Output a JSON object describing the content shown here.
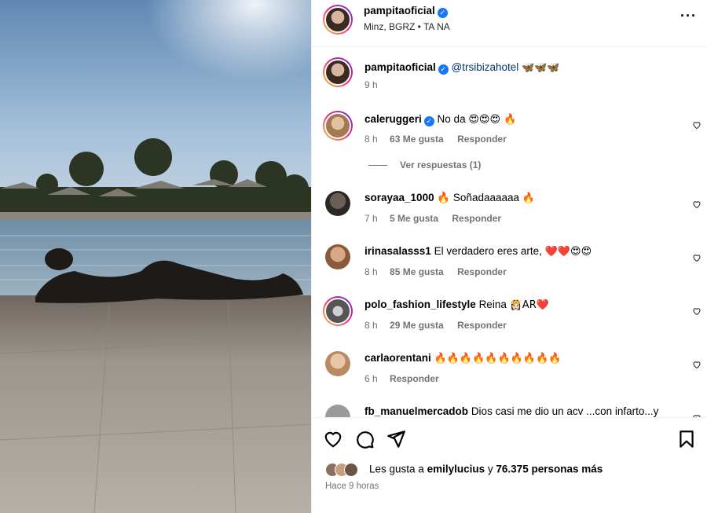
{
  "post": {
    "username": "pampitaoficial",
    "location": "Minz, BGRZ • TA NA"
  },
  "caption": {
    "username": "pampitaoficial",
    "mention": "@trsibizahotel",
    "emojis": "🦋🦋🦋",
    "time": "9 h"
  },
  "comments": [
    {
      "username": "caleruggeri",
      "verified": true,
      "text": "No da",
      "emojis": "😍😍😍 🔥",
      "time": "8 h",
      "likes": "63 Me gusta",
      "reply": "Responder"
    },
    {
      "username": "sorayaa_1000",
      "verified": false,
      "text": "🔥 Soñadaaaaaa",
      "emojis": "🔥",
      "time": "7 h",
      "likes": "5 Me gusta",
      "reply": "Responder"
    },
    {
      "username": "irinasalasss1",
      "verified": false,
      "text": "El verdadero eres arte,",
      "emojis": "❤️❤️😍😍",
      "time": "8 h",
      "likes": "85 Me gusta",
      "reply": "Responder"
    },
    {
      "username": "polo_fashion_lifestyle",
      "verified": false,
      "text": "Reina",
      "emojis": "👸🏻AR❤️",
      "time": "8 h",
      "likes": "29 Me gusta",
      "reply": "Responder"
    },
    {
      "username": "carlaorentani",
      "verified": false,
      "text": "",
      "emojis": "🔥🔥🔥🔥🔥🔥🔥🔥🔥🔥",
      "time": "6 h",
      "likes": "",
      "reply": "Responder"
    },
    {
      "username": "fb_manuelmercadob",
      "verified": false,
      "text": "Dios casi me dio un acv ...con infarto...y",
      "emojis": "",
      "time": "",
      "likes": "",
      "reply": ""
    }
  ],
  "view_replies": "Ver respuestas (1)",
  "likes": {
    "prefix": "Les gusta a",
    "user": "emilylucius",
    "middle": "y",
    "count": "76.375 personas más"
  },
  "posted": "Hace 9 horas",
  "colors": {
    "verified": "#1877f2",
    "muted": "#737373",
    "link": "#00376b"
  }
}
